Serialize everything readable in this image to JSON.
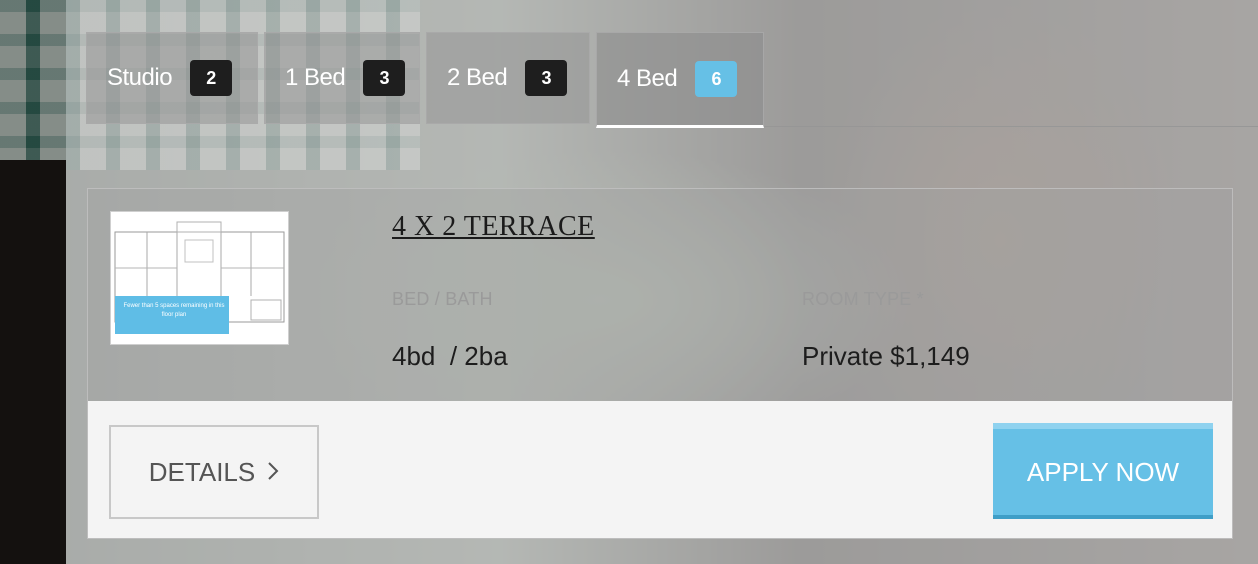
{
  "tabs": [
    {
      "label": "Studio",
      "count": "2"
    },
    {
      "label": "1 Bed",
      "count": "3"
    },
    {
      "label": "2 Bed",
      "count": "3"
    },
    {
      "label": "4 Bed",
      "count": "6",
      "active": true
    }
  ],
  "plan": {
    "title": "4 X 2 TERRACE",
    "thumbnail_caption": "Fewer than 5 spaces remaining in this floor plan",
    "bed_bath_label": "BED / BATH",
    "bed_bath_value": "4bd  / 2ba",
    "room_type_label": "ROOM TYPE *",
    "room_type_value": "Private $1,149"
  },
  "actions": {
    "details_label": "DETAILS",
    "apply_label": "APPLY NOW"
  },
  "colors": {
    "accent": "#66c0e6",
    "badge_dark": "#1e1e1e"
  }
}
